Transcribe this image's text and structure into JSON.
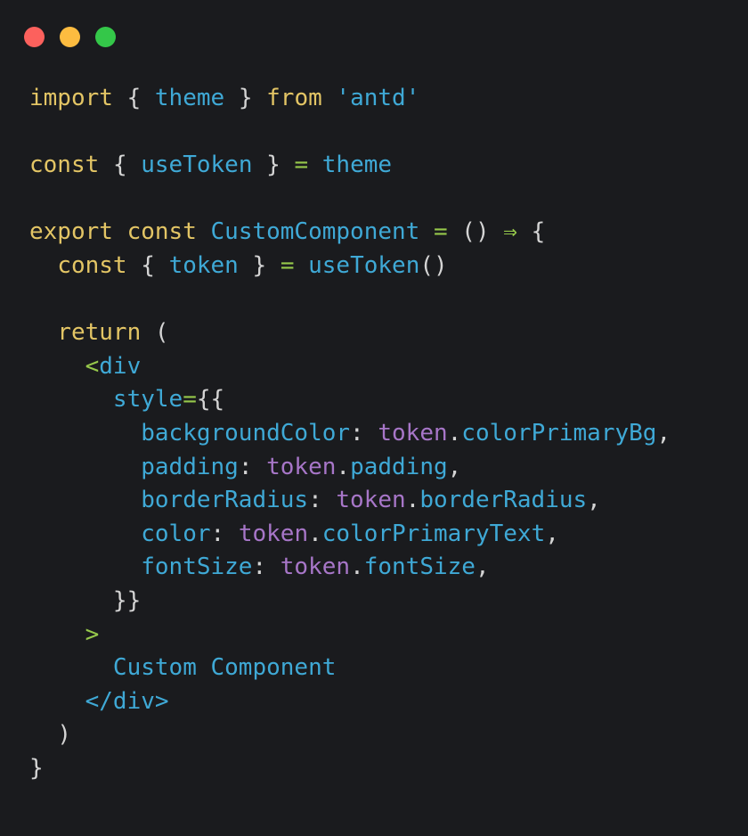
{
  "window": {
    "traffic_lights": [
      {
        "name": "close",
        "color": "#fc615d"
      },
      {
        "name": "minimize",
        "color": "#fdbc40"
      },
      {
        "name": "maximize",
        "color": "#34c749"
      }
    ],
    "background": "#1a1b1e"
  },
  "theme_colors": {
    "keyword": "#e3c565",
    "punctuation": "#d4d4d4",
    "identifier": "#3fa9d6",
    "string": "#3fa9d6",
    "operator": "#96c84b",
    "object": "#a776c8",
    "property": "#3fa9d6",
    "tag": "#3fa9d6",
    "text": "#3fa9d6"
  },
  "code": {
    "language": "tsx",
    "plain_text": "import { theme } from 'antd'\n\nconst { useToken } = theme\n\nexport const CustomComponent = () => {\n  const { token } = useToken()\n\n  return (\n    <div\n      style={{\n        backgroundColor: token.colorPrimaryBg,\n        padding: token.padding,\n        borderRadius: token.borderRadius,\n        color: token.colorPrimaryText,\n        fontSize: token.fontSize,\n      }}\n    >\n      Custom Component\n    </div>\n  )\n}",
    "lines": [
      {
        "id": "l1",
        "tokens": [
          {
            "t": "import",
            "c": "keyword"
          },
          {
            "t": " ",
            "c": "punctuation"
          },
          {
            "t": "{",
            "c": "punctuation"
          },
          {
            "t": " ",
            "c": "punctuation"
          },
          {
            "t": "theme",
            "c": "identifier"
          },
          {
            "t": " ",
            "c": "punctuation"
          },
          {
            "t": "}",
            "c": "punctuation"
          },
          {
            "t": " ",
            "c": "punctuation"
          },
          {
            "t": "from",
            "c": "keyword"
          },
          {
            "t": " ",
            "c": "punctuation"
          },
          {
            "t": "'antd'",
            "c": "string"
          }
        ]
      },
      {
        "id": "l2",
        "tokens": []
      },
      {
        "id": "l3",
        "tokens": [
          {
            "t": "const",
            "c": "keyword"
          },
          {
            "t": " ",
            "c": "punctuation"
          },
          {
            "t": "{",
            "c": "punctuation"
          },
          {
            "t": " ",
            "c": "punctuation"
          },
          {
            "t": "useToken",
            "c": "identifier"
          },
          {
            "t": " ",
            "c": "punctuation"
          },
          {
            "t": "}",
            "c": "punctuation"
          },
          {
            "t": " ",
            "c": "punctuation"
          },
          {
            "t": "=",
            "c": "operator"
          },
          {
            "t": " ",
            "c": "punctuation"
          },
          {
            "t": "theme",
            "c": "identifier"
          }
        ]
      },
      {
        "id": "l4",
        "tokens": []
      },
      {
        "id": "l5",
        "tokens": [
          {
            "t": "export",
            "c": "keyword"
          },
          {
            "t": " ",
            "c": "punctuation"
          },
          {
            "t": "const",
            "c": "keyword"
          },
          {
            "t": " ",
            "c": "punctuation"
          },
          {
            "t": "CustomComponent",
            "c": "identifier"
          },
          {
            "t": " ",
            "c": "punctuation"
          },
          {
            "t": "=",
            "c": "operator"
          },
          {
            "t": " ",
            "c": "punctuation"
          },
          {
            "t": "()",
            "c": "punctuation"
          },
          {
            "t": " ",
            "c": "punctuation"
          },
          {
            "t": "⇒",
            "c": "operator"
          },
          {
            "t": " ",
            "c": "punctuation"
          },
          {
            "t": "{",
            "c": "punctuation"
          }
        ]
      },
      {
        "id": "l6",
        "tokens": [
          {
            "t": "  ",
            "c": "punctuation"
          },
          {
            "t": "const",
            "c": "keyword"
          },
          {
            "t": " ",
            "c": "punctuation"
          },
          {
            "t": "{",
            "c": "punctuation"
          },
          {
            "t": " ",
            "c": "punctuation"
          },
          {
            "t": "token",
            "c": "identifier"
          },
          {
            "t": " ",
            "c": "punctuation"
          },
          {
            "t": "}",
            "c": "punctuation"
          },
          {
            "t": " ",
            "c": "punctuation"
          },
          {
            "t": "=",
            "c": "operator"
          },
          {
            "t": " ",
            "c": "punctuation"
          },
          {
            "t": "useToken",
            "c": "identifier"
          },
          {
            "t": "()",
            "c": "punctuation"
          }
        ]
      },
      {
        "id": "l7",
        "tokens": []
      },
      {
        "id": "l8",
        "tokens": [
          {
            "t": "  ",
            "c": "punctuation"
          },
          {
            "t": "return",
            "c": "keyword"
          },
          {
            "t": " ",
            "c": "punctuation"
          },
          {
            "t": "(",
            "c": "punctuation"
          }
        ]
      },
      {
        "id": "l9",
        "tokens": [
          {
            "t": "    ",
            "c": "punctuation"
          },
          {
            "t": "<",
            "c": "operator"
          },
          {
            "t": "div",
            "c": "tag"
          }
        ]
      },
      {
        "id": "l10",
        "tokens": [
          {
            "t": "      ",
            "c": "punctuation"
          },
          {
            "t": "style",
            "c": "property"
          },
          {
            "t": "=",
            "c": "operator"
          },
          {
            "t": "{{",
            "c": "punctuation"
          }
        ]
      },
      {
        "id": "l11",
        "tokens": [
          {
            "t": "        ",
            "c": "punctuation"
          },
          {
            "t": "backgroundColor",
            "c": "property"
          },
          {
            "t": ": ",
            "c": "punctuation"
          },
          {
            "t": "token",
            "c": "object"
          },
          {
            "t": ".",
            "c": "punctuation"
          },
          {
            "t": "colorPrimaryBg",
            "c": "property"
          },
          {
            "t": ",",
            "c": "punctuation"
          }
        ]
      },
      {
        "id": "l12",
        "tokens": [
          {
            "t": "        ",
            "c": "punctuation"
          },
          {
            "t": "padding",
            "c": "property"
          },
          {
            "t": ": ",
            "c": "punctuation"
          },
          {
            "t": "token",
            "c": "object"
          },
          {
            "t": ".",
            "c": "punctuation"
          },
          {
            "t": "padding",
            "c": "property"
          },
          {
            "t": ",",
            "c": "punctuation"
          }
        ]
      },
      {
        "id": "l13",
        "tokens": [
          {
            "t": "        ",
            "c": "punctuation"
          },
          {
            "t": "borderRadius",
            "c": "property"
          },
          {
            "t": ": ",
            "c": "punctuation"
          },
          {
            "t": "token",
            "c": "object"
          },
          {
            "t": ".",
            "c": "punctuation"
          },
          {
            "t": "borderRadius",
            "c": "property"
          },
          {
            "t": ",",
            "c": "punctuation"
          }
        ]
      },
      {
        "id": "l14",
        "tokens": [
          {
            "t": "        ",
            "c": "punctuation"
          },
          {
            "t": "color",
            "c": "property"
          },
          {
            "t": ": ",
            "c": "punctuation"
          },
          {
            "t": "token",
            "c": "object"
          },
          {
            "t": ".",
            "c": "punctuation"
          },
          {
            "t": "colorPrimaryText",
            "c": "property"
          },
          {
            "t": ",",
            "c": "punctuation"
          }
        ]
      },
      {
        "id": "l15",
        "tokens": [
          {
            "t": "        ",
            "c": "punctuation"
          },
          {
            "t": "fontSize",
            "c": "property"
          },
          {
            "t": ": ",
            "c": "punctuation"
          },
          {
            "t": "token",
            "c": "object"
          },
          {
            "t": ".",
            "c": "punctuation"
          },
          {
            "t": "fontSize",
            "c": "property"
          },
          {
            "t": ",",
            "c": "punctuation"
          }
        ]
      },
      {
        "id": "l16",
        "tokens": [
          {
            "t": "      ",
            "c": "punctuation"
          },
          {
            "t": "}}",
            "c": "punctuation"
          }
        ]
      },
      {
        "id": "l17",
        "tokens": [
          {
            "t": "    ",
            "c": "punctuation"
          },
          {
            "t": ">",
            "c": "operator"
          }
        ]
      },
      {
        "id": "l18",
        "tokens": [
          {
            "t": "      ",
            "c": "punctuation"
          },
          {
            "t": "Custom Component",
            "c": "text"
          }
        ]
      },
      {
        "id": "l19",
        "tokens": [
          {
            "t": "    ",
            "c": "punctuation"
          },
          {
            "t": "</div>",
            "c": "tag"
          }
        ]
      },
      {
        "id": "l20",
        "tokens": [
          {
            "t": "  ",
            "c": "punctuation"
          },
          {
            "t": ")",
            "c": "punctuation"
          }
        ]
      },
      {
        "id": "l21",
        "tokens": [
          {
            "t": "}",
            "c": "punctuation"
          }
        ]
      }
    ]
  }
}
